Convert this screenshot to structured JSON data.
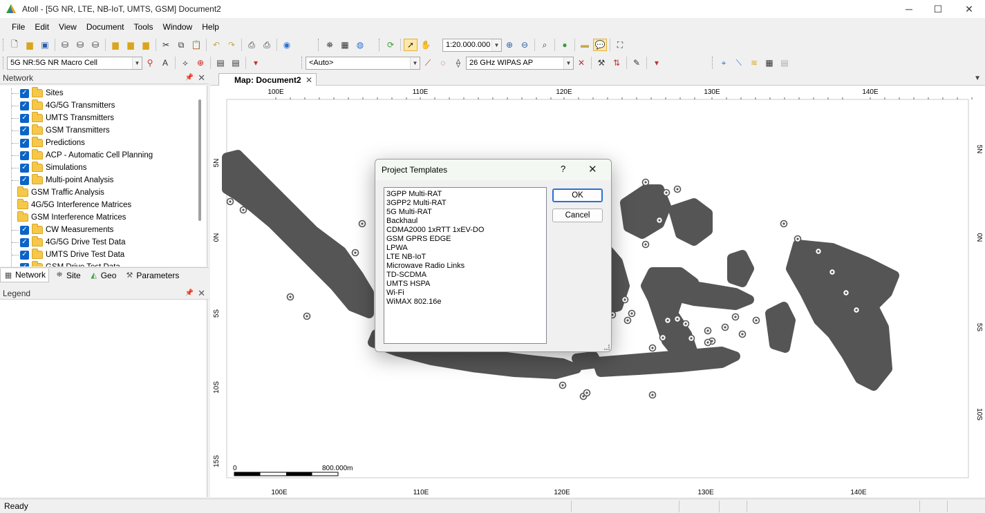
{
  "window": {
    "title": "Atoll - [5G NR, LTE, NB-IoT, UMTS, GSM] Document2",
    "controls": [
      "minimize",
      "maximize",
      "close"
    ]
  },
  "menu": [
    "File",
    "Edit",
    "View",
    "Document",
    "Tools",
    "Window",
    "Help"
  ],
  "toolbar1": {
    "zoom_scale": "1:20.000.000"
  },
  "toolbar2": {
    "technology_combo": "5G NR:5G NR Macro Cell",
    "auto_combo": "<Auto>",
    "frequency_combo": "26 GHz WIPAS AP"
  },
  "network_panel": {
    "title": "Network",
    "items": [
      {
        "label": "Sites",
        "checked": true,
        "folder": true
      },
      {
        "label": "4G/5G Transmitters",
        "checked": true,
        "folder": true
      },
      {
        "label": "UMTS Transmitters",
        "checked": true,
        "folder": true
      },
      {
        "label": "GSM Transmitters",
        "checked": true,
        "folder": true
      },
      {
        "label": "Predictions",
        "checked": true,
        "folder": true
      },
      {
        "label": "ACP - Automatic Cell Planning",
        "checked": true,
        "folder": true
      },
      {
        "label": "Simulations",
        "checked": true,
        "folder": true
      },
      {
        "label": "Multi-point Analysis",
        "checked": true,
        "folder": true
      },
      {
        "label": "GSM Traffic Analysis",
        "checked": false,
        "folder": true
      },
      {
        "label": "4G/5G Interference Matrices",
        "checked": false,
        "folder": true
      },
      {
        "label": "GSM Interference Matrices",
        "checked": false,
        "folder": true
      },
      {
        "label": "CW Measurements",
        "checked": true,
        "folder": true
      },
      {
        "label": "4G/5G Drive Test Data",
        "checked": true,
        "folder": true
      },
      {
        "label": "UMTS Drive Test Data",
        "checked": true,
        "folder": true
      },
      {
        "label": "GSM Drive Test Data",
        "checked": true,
        "folder": true
      }
    ]
  },
  "panel_tabs": [
    "Network",
    "Site",
    "Geo",
    "Parameters"
  ],
  "legend_panel": {
    "title": "Legend"
  },
  "map": {
    "tab_label": "Map: Document2",
    "top_ticks": [
      "100E",
      "110E",
      "120E",
      "130E",
      "140E"
    ],
    "bottom_ticks": [
      "100E",
      "110E",
      "120E",
      "130E",
      "140E"
    ],
    "left_ticks": [
      "5N",
      "0N",
      "5S",
      "10S",
      "15S"
    ],
    "right_ticks": [
      "5N",
      "0N",
      "5S",
      "10S"
    ],
    "scale_start": "0",
    "scale_end": "800.000m",
    "site_color": "#555555"
  },
  "dialog": {
    "title": "Project Templates",
    "help": "?",
    "close": "✕",
    "templates": [
      "3GPP Multi-RAT",
      "3GPP2 Multi-RAT",
      "5G Multi-RAT",
      "Backhaul",
      "CDMA2000 1xRTT 1xEV-DO",
      "GSM GPRS EDGE",
      "LPWA",
      "LTE NB-IoT",
      "Microwave Radio Links",
      "TD-SCDMA",
      "UMTS HSPA",
      "Wi-Fi",
      "WiMAX 802.16e"
    ],
    "ok_label": "OK",
    "cancel_label": "Cancel"
  },
  "status": {
    "text": "Ready"
  }
}
